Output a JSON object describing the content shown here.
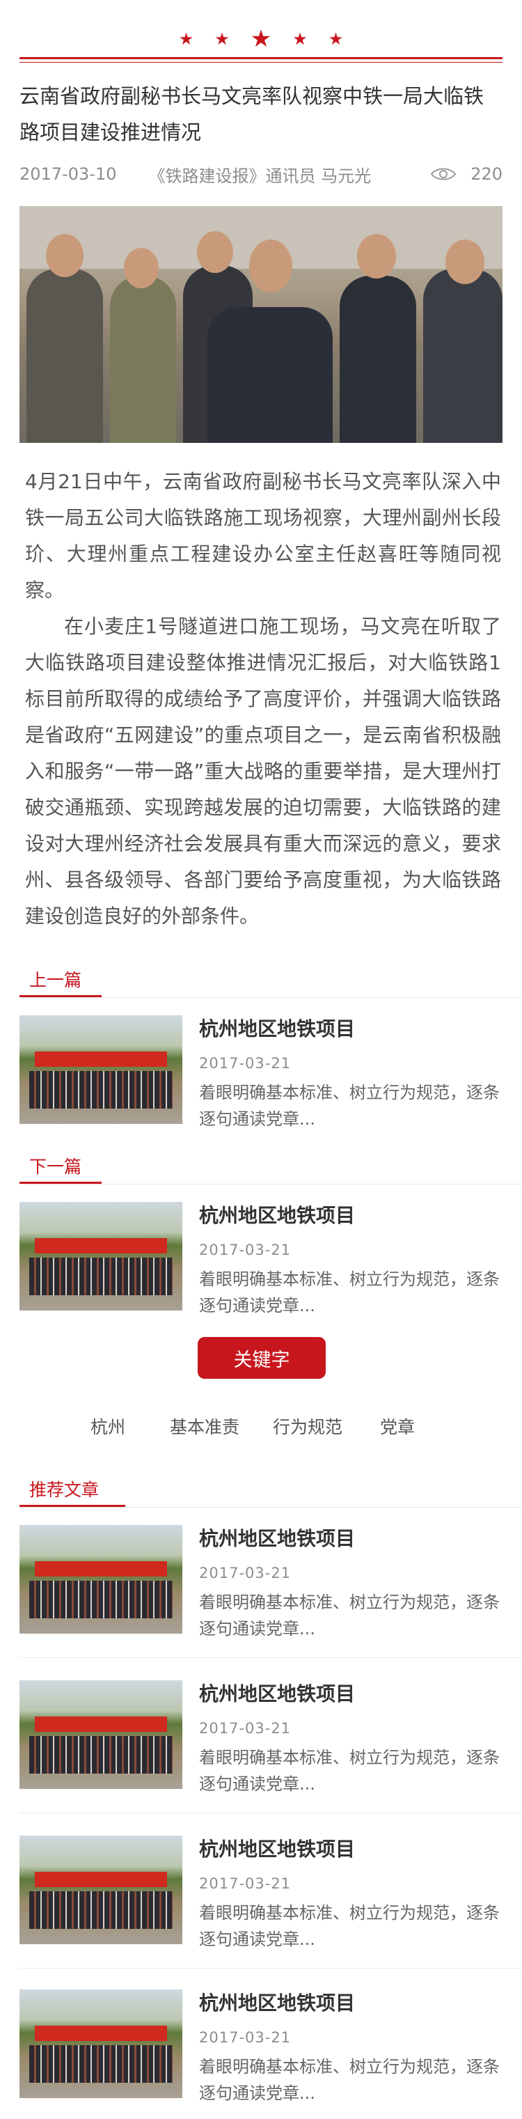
{
  "header": {
    "star_glyph": "★",
    "accent_color": "#c8161d"
  },
  "article": {
    "title": "云南省政府副秘书长马文亮率队视察中铁一局大临铁路项目建设推进情况",
    "date": "2017-03-10",
    "source": "《铁路建设报》通讯员 马元光",
    "views": "220",
    "views_icon": "eye-icon",
    "paragraphs": [
      "4月21日中午，云南省政府副秘书长马文亮率队深入中铁一局五公司大临铁路施工现场视察，大理州副州长段玠、大理州重点工程建设办公室主任赵喜旺等随同视察。",
      "在小麦庄1号隧道进口施工现场，马文亮在听取了大临铁路项目建设整体推进情况汇报后，对大临铁路1标目前所取得的成绩给予了高度评价，并强调大临铁路是省政府“五网建设”的重点项目之一，是云南省积极融入和服务“一带一路”重大战略的重要举措，是大理州打破交通瓶颈、实现跨越发展的迫切需要，大临铁路的建设对大理州经济社会发展具有重大而深远的意义，要求州、县各级领导、各部门要给予高度重视，为大临铁路建设创造良好的外部条件。"
    ]
  },
  "prev": {
    "label": "上一篇",
    "item": {
      "title": "杭州地区地铁项目",
      "date": "2017-03-21",
      "desc": "着眼明确基本标准、树立行为规范，逐条逐句通读党章..."
    }
  },
  "next": {
    "label": "下一篇",
    "item": {
      "title": "杭州地区地铁项目",
      "date": "2017-03-21",
      "desc": "着眼明确基本标准、树立行为规范，逐条逐句通读党章..."
    }
  },
  "keywords": {
    "button_label": "关键字",
    "tags": [
      "杭州",
      "基本准责",
      "行为规范",
      "党章"
    ]
  },
  "recommended": {
    "label": "推荐文章",
    "items": [
      {
        "title": "杭州地区地铁项目",
        "date": "2017-03-21",
        "desc": "着眼明确基本标准、树立行为规范，逐条逐句通读党章..."
      },
      {
        "title": "杭州地区地铁项目",
        "date": "2017-03-21",
        "desc": "着眼明确基本标准、树立行为规范，逐条逐句通读党章..."
      },
      {
        "title": "杭州地区地铁项目",
        "date": "2017-03-21",
        "desc": "着眼明确基本标准、树立行为规范，逐条逐句通读党章..."
      },
      {
        "title": "杭州地区地铁项目",
        "date": "2017-03-21",
        "desc": "着眼明确基本标准、树立行为规范，逐条逐句通读党章..."
      }
    ]
  }
}
